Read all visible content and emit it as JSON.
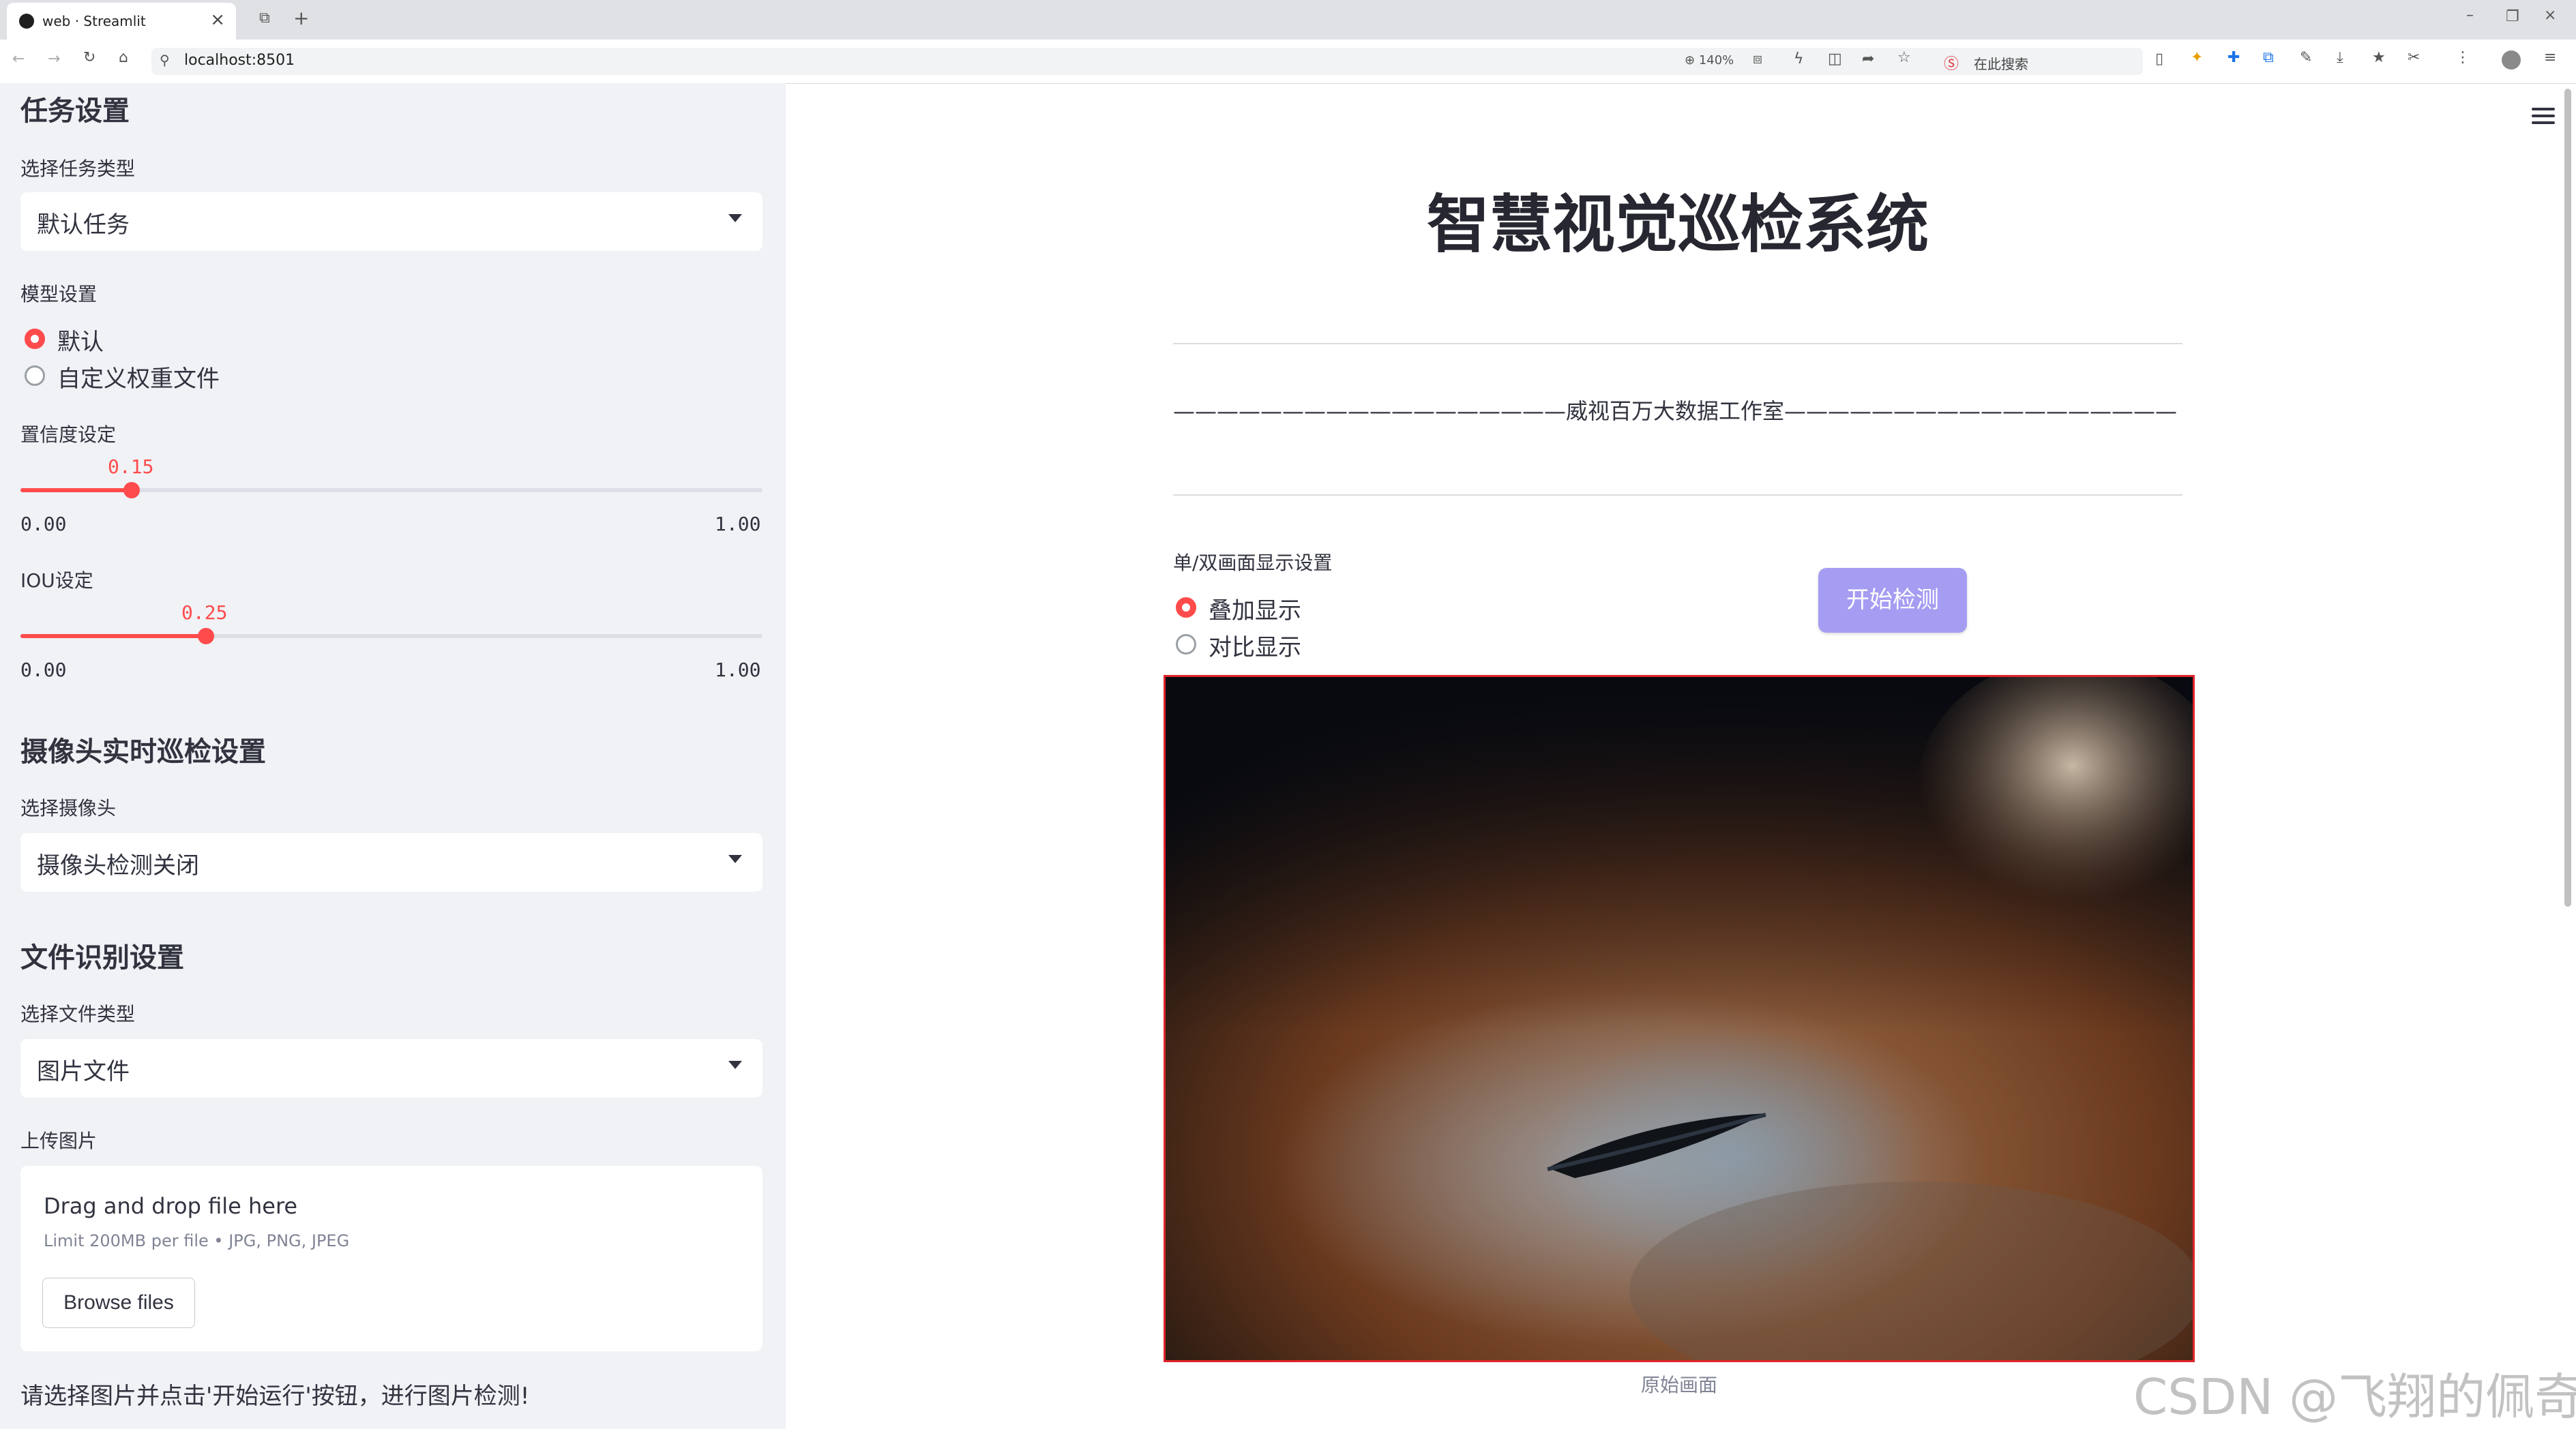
{
  "browser": {
    "tab_title": "web · Streamlit",
    "url": "localhost:8501",
    "zoom": "140%",
    "search_placeholder": "在此搜索"
  },
  "sidebar": {
    "task_header": "任务设置",
    "task_type_label": "选择任务类型",
    "task_type_value": "默认任务",
    "model_label": "模型设置",
    "model_options": [
      "默认",
      "自定义权重文件"
    ],
    "model_selected": "默认",
    "conf_label": "置信度设定",
    "conf_value": "0.15",
    "conf_min": "0.00",
    "conf_max": "1.00",
    "conf_fraction": 0.15,
    "iou_label": "IOU设定",
    "iou_value": "0.25",
    "iou_min": "0.00",
    "iou_max": "1.00",
    "iou_fraction": 0.25,
    "camera_header": "摄像头实时巡检设置",
    "camera_label": "选择摄像头",
    "camera_value": "摄像头检测关闭",
    "file_header": "文件识别设置",
    "file_type_label": "选择文件类型",
    "file_type_value": "图片文件",
    "upload_label": "上传图片",
    "upload_drag": "Drag and drop file here",
    "upload_limit": "Limit 200MB per file • JPG, PNG, JPEG",
    "browse_label": "Browse files",
    "hint": "请选择图片并点击'开始运行'按钮，进行图片检测!"
  },
  "main": {
    "title": "智慧视觉巡检系统",
    "dash_line": "——————————————————威视百万大数据工作室——————————————————",
    "display_label": "单/双画面显示设置",
    "display_options": [
      "叠加显示",
      "对比显示"
    ],
    "display_selected": "叠加显示",
    "start_button": "开始检测",
    "image_caption": "原始画面"
  },
  "watermark": "CSDN @飞翔的佩奇",
  "colors": {
    "accent": "#ff4b4b",
    "button": "#a59df2",
    "sidebar_bg": "#f0f2f6"
  }
}
